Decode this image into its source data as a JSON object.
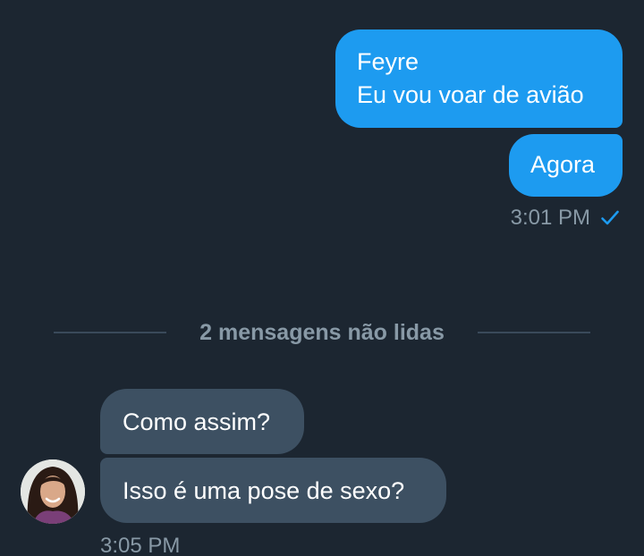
{
  "conversation": {
    "outgoing": [
      {
        "lines": [
          "Feyre",
          "Eu vou voar de avião"
        ]
      },
      {
        "lines": [
          "Agora"
        ]
      }
    ],
    "outgoing_time": "3:01 PM",
    "unread_divider": "2 mensagens não lidas",
    "incoming": [
      {
        "text": "Como assim?"
      },
      {
        "text": "Isso é uma pose de sexo?"
      }
    ],
    "incoming_time": "3:05 PM"
  },
  "colors": {
    "background": "#1c2631",
    "outgoing_bubble": "#1d9bf0",
    "incoming_bubble": "#3d5062",
    "meta_text": "#8899a6",
    "check_icon": "#1d9bf0"
  },
  "icons": {
    "read_receipt": "check-icon",
    "contact_avatar": "avatar"
  }
}
